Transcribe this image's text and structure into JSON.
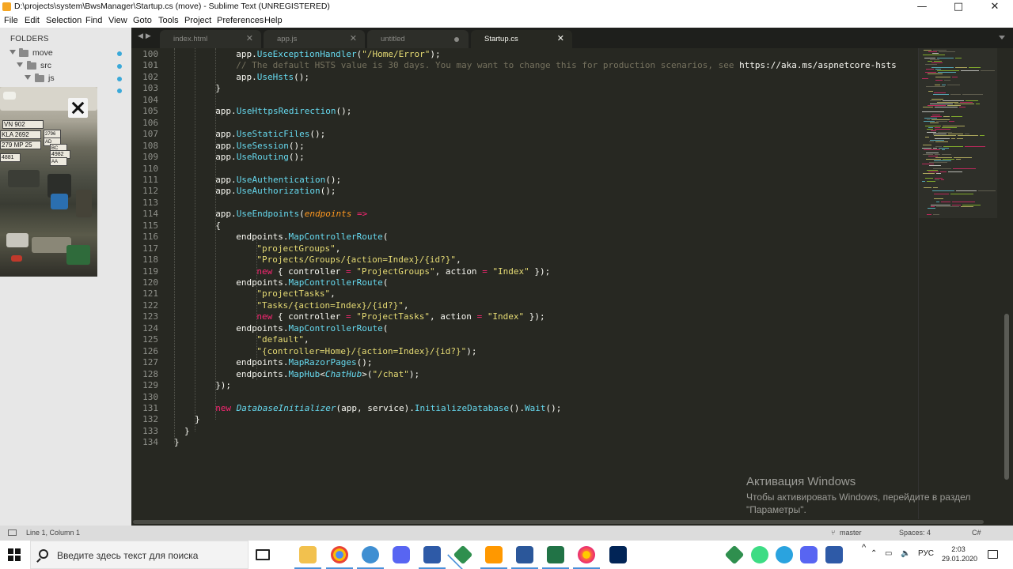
{
  "window": {
    "title": "D:\\projects\\system\\BwsManager\\Startup.cs (move) - Sublime Text (UNREGISTERED)",
    "controls": {
      "minimize": "—",
      "maximize": "□",
      "close": "✕"
    }
  },
  "menu": [
    "File",
    "Edit",
    "Selection",
    "Find",
    "View",
    "Goto",
    "Tools",
    "Project",
    "Preferences",
    "Help"
  ],
  "sidebar": {
    "header": "FOLDERS",
    "tree": [
      {
        "name": "move",
        "depth": 0
      },
      {
        "name": "src",
        "depth": 1
      },
      {
        "name": "js",
        "depth": 2
      }
    ],
    "camera_plates": [
      "VN 902",
      "KLA 2692",
      "2796",
      "AD",
      "279 MP 25",
      "BC",
      "4982",
      "AA",
      "4881"
    ]
  },
  "tabs": [
    {
      "label": "index.html",
      "state": "close"
    },
    {
      "label": "app.js",
      "state": "close"
    },
    {
      "label": "untitled",
      "state": "dirty"
    },
    {
      "label": "Startup.cs",
      "state": "close",
      "active": true
    }
  ],
  "editor": {
    "first_line_number": 100,
    "lines": [
      {
        "n": "100",
        "indent": 3,
        "tokens": [
          [
            "t-plain",
            "app."
          ],
          [
            "t-fn",
            "UseExceptionHandler"
          ],
          [
            "t-plain",
            "("
          ],
          [
            "t-str",
            "\"/Home/Error\""
          ],
          [
            "t-plain",
            ");"
          ]
        ]
      },
      {
        "n": "101",
        "indent": 3,
        "tokens": [
          [
            "t-cmt",
            "// The default HSTS value is 30 days. You may want to change this for production scenarios, see "
          ],
          [
            "t-plain",
            "https://aka.ms/aspnetcore-hsts"
          ]
        ]
      },
      {
        "n": "102",
        "indent": 3,
        "tokens": [
          [
            "t-plain",
            "app."
          ],
          [
            "t-fn",
            "UseHsts"
          ],
          [
            "t-plain",
            "();"
          ]
        ]
      },
      {
        "n": "103",
        "indent": 2,
        "tokens": [
          [
            "t-plain",
            "}"
          ]
        ]
      },
      {
        "n": "104",
        "indent": 0,
        "tokens": []
      },
      {
        "n": "105",
        "indent": 2,
        "tokens": [
          [
            "t-plain",
            "app."
          ],
          [
            "t-fn",
            "UseHttpsRedirection"
          ],
          [
            "t-plain",
            "();"
          ]
        ]
      },
      {
        "n": "106",
        "indent": 0,
        "tokens": []
      },
      {
        "n": "107",
        "indent": 2,
        "tokens": [
          [
            "t-plain",
            "app."
          ],
          [
            "t-fn",
            "UseStaticFiles"
          ],
          [
            "t-plain",
            "();"
          ]
        ]
      },
      {
        "n": "108",
        "indent": 2,
        "tokens": [
          [
            "t-plain",
            "app."
          ],
          [
            "t-fn",
            "UseSession"
          ],
          [
            "t-plain",
            "();"
          ]
        ]
      },
      {
        "n": "109",
        "indent": 2,
        "tokens": [
          [
            "t-plain",
            "app."
          ],
          [
            "t-fn",
            "UseRouting"
          ],
          [
            "t-plain",
            "();"
          ]
        ]
      },
      {
        "n": "110",
        "indent": 0,
        "tokens": []
      },
      {
        "n": "111",
        "indent": 2,
        "tokens": [
          [
            "t-plain",
            "app."
          ],
          [
            "t-fn",
            "UseAuthentication"
          ],
          [
            "t-plain",
            "();"
          ]
        ]
      },
      {
        "n": "112",
        "indent": 2,
        "tokens": [
          [
            "t-plain",
            "app."
          ],
          [
            "t-fn",
            "UseAuthorization"
          ],
          [
            "t-plain",
            "();"
          ]
        ]
      },
      {
        "n": "113",
        "indent": 0,
        "tokens": []
      },
      {
        "n": "114",
        "indent": 2,
        "tokens": [
          [
            "t-plain",
            "app."
          ],
          [
            "t-fn",
            "UseEndpoints"
          ],
          [
            "t-plain",
            "("
          ],
          [
            "t-param",
            "endpoints"
          ],
          [
            "t-plain",
            " "
          ],
          [
            "t-op",
            "=>"
          ]
        ]
      },
      {
        "n": "115",
        "indent": 2,
        "tokens": [
          [
            "t-plain",
            "{"
          ]
        ]
      },
      {
        "n": "116",
        "indent": 3,
        "tokens": [
          [
            "t-plain",
            "endpoints."
          ],
          [
            "t-fn",
            "MapControllerRoute"
          ],
          [
            "t-plain",
            "("
          ]
        ]
      },
      {
        "n": "117",
        "indent": 4,
        "tokens": [
          [
            "t-str",
            "\"projectGroups\""
          ],
          [
            "t-plain",
            ","
          ]
        ]
      },
      {
        "n": "118",
        "indent": 4,
        "tokens": [
          [
            "t-str",
            "\"Projects/Groups/{action=Index}/{id?}\""
          ],
          [
            "t-plain",
            ","
          ]
        ]
      },
      {
        "n": "119",
        "indent": 4,
        "tokens": [
          [
            "t-kw",
            "new"
          ],
          [
            "t-plain",
            " { controller "
          ],
          [
            "t-op",
            "="
          ],
          [
            "t-plain",
            " "
          ],
          [
            "t-str",
            "\"ProjectGroups\""
          ],
          [
            "t-plain",
            ", action "
          ],
          [
            "t-op",
            "="
          ],
          [
            "t-plain",
            " "
          ],
          [
            "t-str",
            "\"Index\""
          ],
          [
            "t-plain",
            " });"
          ]
        ]
      },
      {
        "n": "120",
        "indent": 3,
        "tokens": [
          [
            "t-plain",
            "endpoints."
          ],
          [
            "t-fn",
            "MapControllerRoute"
          ],
          [
            "t-plain",
            "("
          ]
        ]
      },
      {
        "n": "121",
        "indent": 4,
        "tokens": [
          [
            "t-str",
            "\"projectTasks\""
          ],
          [
            "t-plain",
            ","
          ]
        ]
      },
      {
        "n": "122",
        "indent": 4,
        "tokens": [
          [
            "t-str",
            "\"Tasks/{action=Index}/{id?}\""
          ],
          [
            "t-plain",
            ","
          ]
        ]
      },
      {
        "n": "123",
        "indent": 4,
        "tokens": [
          [
            "t-kw",
            "new"
          ],
          [
            "t-plain",
            " { controller "
          ],
          [
            "t-op",
            "="
          ],
          [
            "t-plain",
            " "
          ],
          [
            "t-str",
            "\"ProjectTasks\""
          ],
          [
            "t-plain",
            ", action "
          ],
          [
            "t-op",
            "="
          ],
          [
            "t-plain",
            " "
          ],
          [
            "t-str",
            "\"Index\""
          ],
          [
            "t-plain",
            " });"
          ]
        ]
      },
      {
        "n": "124",
        "indent": 3,
        "tokens": [
          [
            "t-plain",
            "endpoints."
          ],
          [
            "t-fn",
            "MapControllerRoute"
          ],
          [
            "t-plain",
            "("
          ]
        ]
      },
      {
        "n": "125",
        "indent": 4,
        "tokens": [
          [
            "t-str",
            "\"default\""
          ],
          [
            "t-plain",
            ","
          ]
        ]
      },
      {
        "n": "126",
        "indent": 4,
        "tokens": [
          [
            "t-str",
            "\"{controller=Home}/{action=Index}/{id?}\""
          ],
          [
            "t-plain",
            ");"
          ]
        ]
      },
      {
        "n": "127",
        "indent": 3,
        "tokens": [
          [
            "t-plain",
            "endpoints."
          ],
          [
            "t-fn",
            "MapRazorPages"
          ],
          [
            "t-plain",
            "();"
          ]
        ]
      },
      {
        "n": "128",
        "indent": 3,
        "tokens": [
          [
            "t-plain",
            "endpoints."
          ],
          [
            "t-fn",
            "MapHub"
          ],
          [
            "t-plain",
            "<"
          ],
          [
            "t-type",
            "ChatHub"
          ],
          [
            "t-plain",
            ">("
          ],
          [
            "t-str",
            "\"/chat\""
          ],
          [
            "t-plain",
            ");"
          ]
        ]
      },
      {
        "n": "129",
        "indent": 2,
        "tokens": [
          [
            "t-plain",
            "});"
          ]
        ]
      },
      {
        "n": "130",
        "indent": 0,
        "tokens": []
      },
      {
        "n": "131",
        "indent": 2,
        "tokens": [
          [
            "t-kw",
            "new"
          ],
          [
            "t-plain",
            " "
          ],
          [
            "t-type",
            "DatabaseInitializer"
          ],
          [
            "t-plain",
            "(app, service)."
          ],
          [
            "t-fn",
            "InitializeDatabase"
          ],
          [
            "t-plain",
            "()."
          ],
          [
            "t-fn",
            "Wait"
          ],
          [
            "t-plain",
            "();"
          ]
        ]
      },
      {
        "n": "132",
        "indent": 1,
        "tokens": [
          [
            "t-plain",
            "}"
          ]
        ]
      },
      {
        "n": "133",
        "indent": 0.5,
        "tokens": [
          [
            "t-plain",
            "}"
          ]
        ]
      },
      {
        "n": "134",
        "indent": 0,
        "tokens": [
          [
            "t-plain",
            "}"
          ]
        ]
      }
    ]
  },
  "watermark": {
    "title": "Активация Windows",
    "text": "Чтобы активировать Windows, перейдите в раздел \"Параметры\"."
  },
  "status": {
    "position": "Line 1, Column 1",
    "branch": "master",
    "indent": "Spaces: 4",
    "syntax": "C#"
  },
  "taskbar": {
    "search_placeholder": "Введите здесь текст для поиска",
    "apps": [
      "task-view",
      "file-explorer",
      "chrome",
      "bubble-app",
      "discord",
      "network-tool",
      "git-tool",
      "sublime-text",
      "word",
      "excel",
      "firefox",
      "powershell"
    ],
    "tray": {
      "chevron": "^",
      "lang": "РУС",
      "time": "2:03",
      "date": "29.01.2020"
    }
  },
  "colors": {
    "editor_bg": "#272822",
    "tab_bar_bg": "#1e1f1c",
    "sidebar_bg": "#e7e7e7",
    "accent_dot": "#3aa9d9"
  }
}
